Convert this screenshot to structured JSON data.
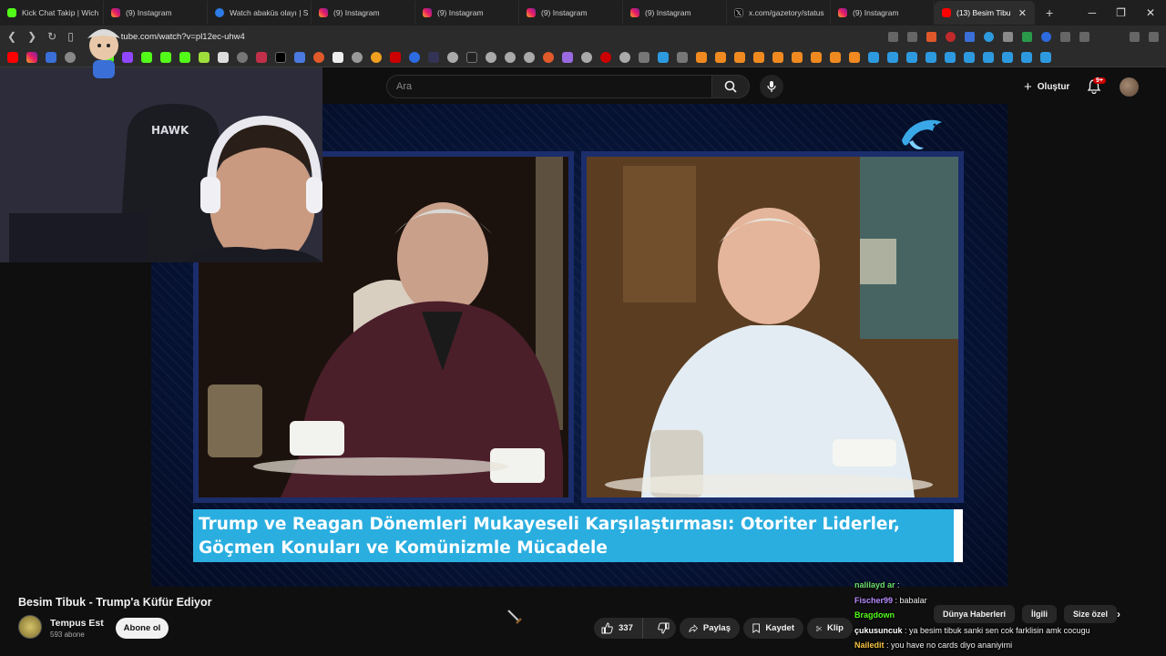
{
  "browser": {
    "tabs": [
      {
        "label": "Kick Chat Takip | Wich",
        "icon": "kick-icon"
      },
      {
        "label": "(9) Instagram",
        "icon": "instagram-icon"
      },
      {
        "label": "Watch abaküs olayı | S",
        "icon": "globe-icon"
      },
      {
        "label": "(9) Instagram",
        "icon": "instagram-icon"
      },
      {
        "label": "(9) Instagram",
        "icon": "instagram-icon"
      },
      {
        "label": "(9) Instagram",
        "icon": "instagram-icon"
      },
      {
        "label": "(9) Instagram",
        "icon": "instagram-icon"
      },
      {
        "label": "x.com/gazetory/status",
        "icon": "x-icon"
      },
      {
        "label": "(9) Instagram",
        "icon": "instagram-icon"
      },
      {
        "label": "(13) Besim Tibu",
        "icon": "youtube-icon",
        "active": true
      }
    ],
    "url": "tube.com/watch?v=pl12ec-uhw4"
  },
  "youtube": {
    "search_placeholder": "Ara",
    "create_label": "Oluştur",
    "notification_count": "9+"
  },
  "video": {
    "caption": "Trump ve Reagan Dönemleri Mukayeseli Karşılaştırması: Otoriter Liderler, Göçmen Konuları ve Komünizmle Mücadele",
    "webcam_text": "HAWK"
  },
  "meta": {
    "title": "Besim Tibuk - Trump'a Küfür Ediyor",
    "channel_name": "Tempus Est",
    "subscribers": "593 abone",
    "subscribe_label": "Abone ol",
    "like_count": "337",
    "share_label": "Paylaş",
    "save_label": "Kaydet",
    "clip_label": "Klip"
  },
  "chips": [
    "Dünya Haberleri",
    "İlgili",
    "Size özel"
  ],
  "chat": [
    {
      "user": "nalilayd ar",
      "text": ":",
      "color": "#6ee06e"
    },
    {
      "user": "Fischer99",
      "text": ": babalar",
      "color": "#b78cff"
    },
    {
      "user": "Bragdown",
      "text": "",
      "color": "#53fc18"
    },
    {
      "user": "çukusuncuk",
      "text": ": ya besim tibuk sanki sen cok farklisin amk cocugu",
      "color": "#ffffff"
    },
    {
      "user": "Nailedit",
      "text": ": you have no cards diyo ananiyimi",
      "color": "#f5c542"
    }
  ]
}
